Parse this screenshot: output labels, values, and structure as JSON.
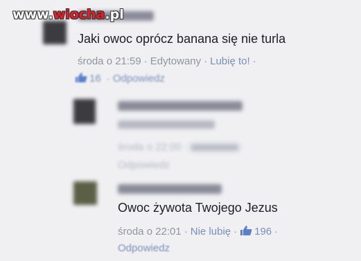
{
  "watermark": {
    "part1": "www.",
    "part2": "wiocha",
    "part3": ".pl"
  },
  "comment1": {
    "text": "Jaki owoc oprócz banana się nie turla",
    "time": "środa o 21:59",
    "edited": "Edytowany",
    "like": "Lubię to!",
    "likes_count": "16",
    "reply": "Odpowiedz"
  },
  "comment2": {
    "time": "środa o 22:00",
    "reply": "Odpowiedz"
  },
  "comment3": {
    "text": "Owoc żywota Twojego Jezus",
    "time": "środa o 22:01",
    "unlike": "Nie lubię",
    "likes_count": "196",
    "reply": "Odpowiedz"
  },
  "colors": {
    "link": "#7a8fb8",
    "meta": "#90949c",
    "text": "#1c1e21",
    "like_blue": "#5b7fc9"
  }
}
